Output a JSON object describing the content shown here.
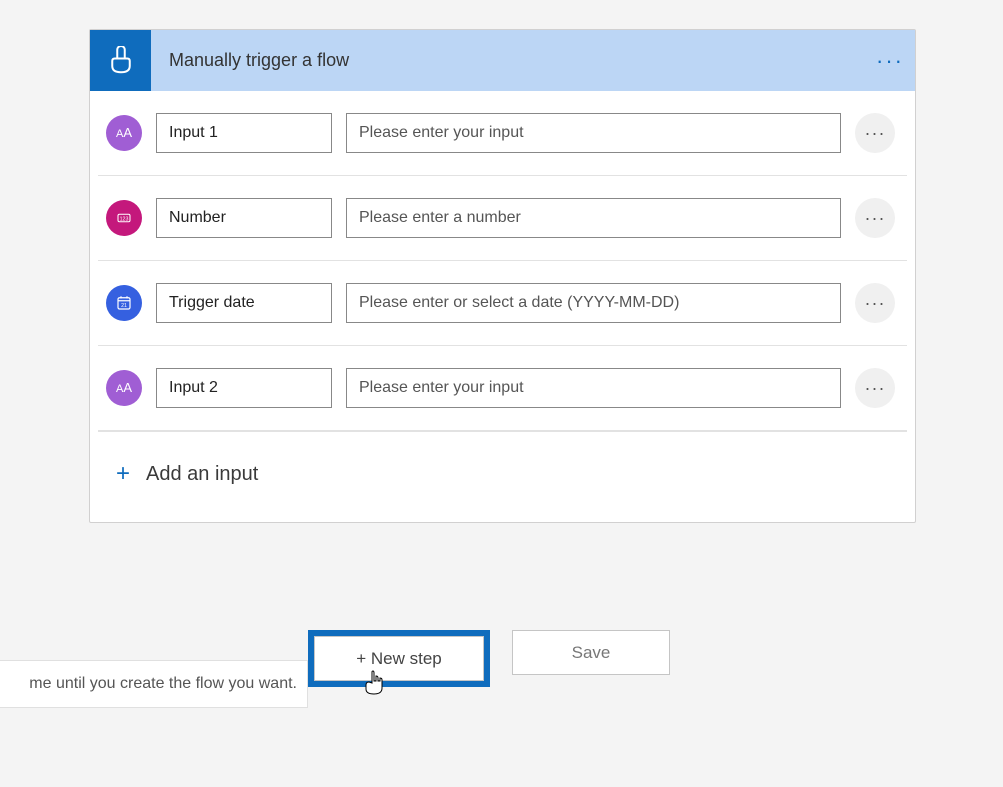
{
  "trigger": {
    "title": "Manually trigger a flow",
    "inputs": [
      {
        "name": "Input 1",
        "placeholder": "Please enter your input",
        "icon": "text"
      },
      {
        "name": "Number",
        "placeholder": "Please enter a number",
        "icon": "number"
      },
      {
        "name": "Trigger date",
        "placeholder": "Please enter or select a date (YYYY-MM-DD)",
        "icon": "date"
      },
      {
        "name": "Input 2",
        "placeholder": "Please enter your input",
        "icon": "text"
      }
    ],
    "add_input_label": "Add an input"
  },
  "footer": {
    "new_step_label": "New step",
    "save_label": "Save",
    "hint_fragment": "me until you create the flow you want."
  },
  "colors": {
    "accent": "#0f6cbd",
    "header_bg": "#bcd6f5",
    "text_icon": "#a05ed4",
    "number_icon": "#c4187c",
    "date_icon": "#3560e0"
  }
}
